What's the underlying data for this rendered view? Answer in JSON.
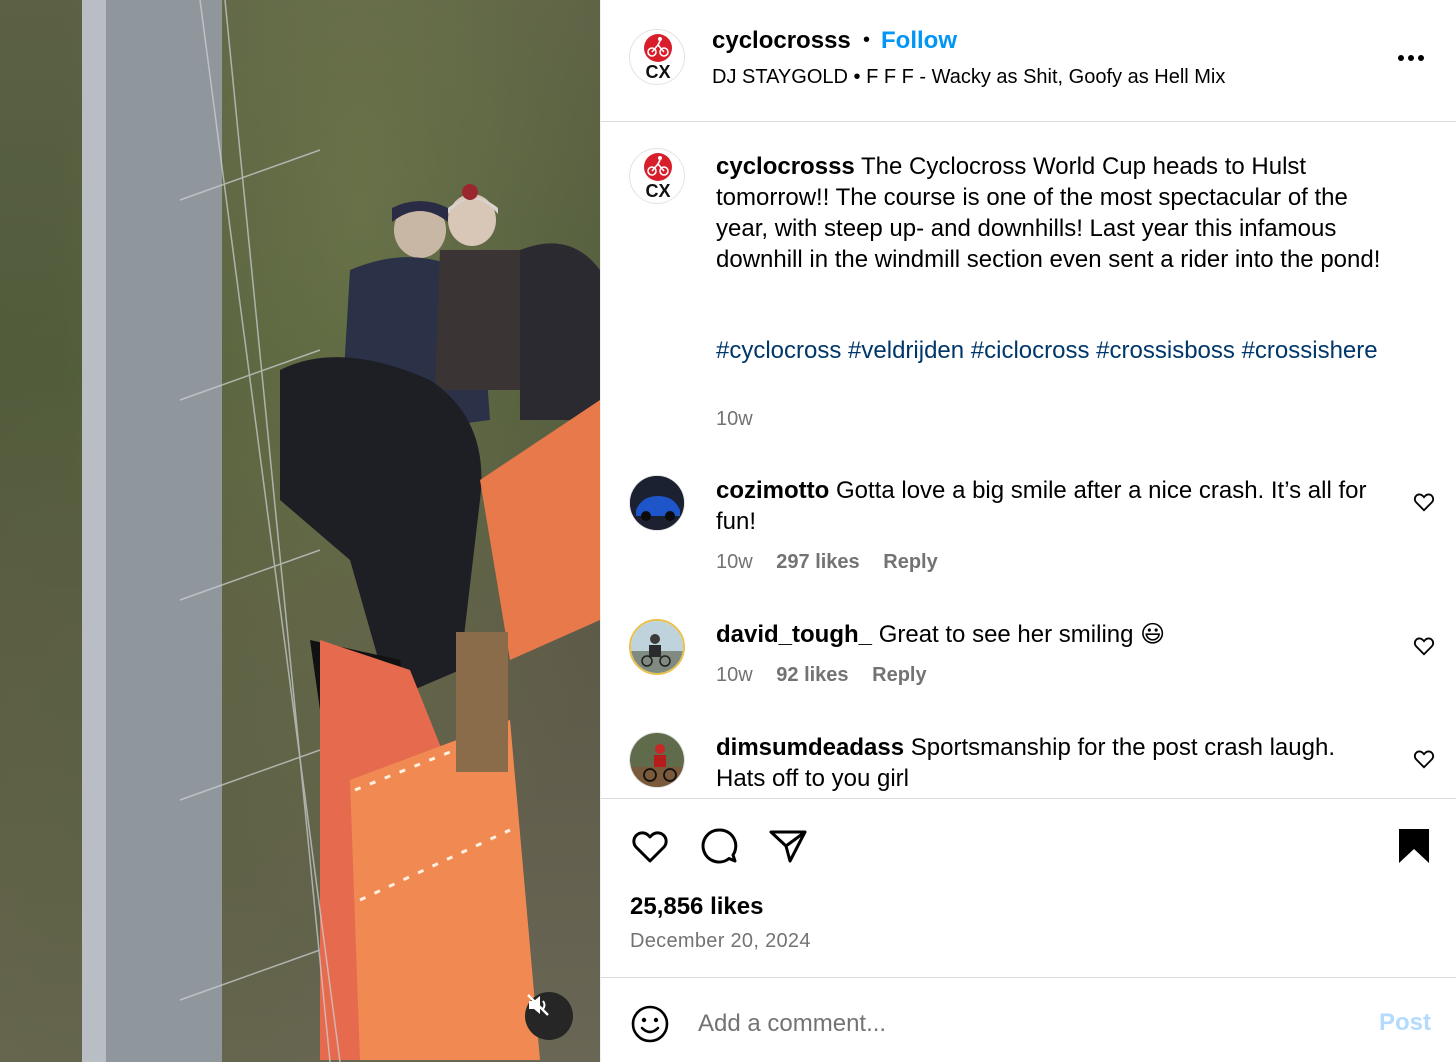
{
  "header": {
    "username": "cyclocrosss",
    "separator": "•",
    "follow_label": "Follow",
    "audio": "DJ STAYGOLD • F F F - Wacky as Shit, Goofy as Hell Mix",
    "avatar_text": "CX"
  },
  "caption": {
    "username": "cyclocrosss",
    "text": "The Cyclocross World Cup heads to Hulst tomorrow!! The course is one of the most spectacular of the year, with steep up- and downhills! Last year this infamous downhill in the windmill section even sent a rider into the pond!",
    "hashtags": [
      "#cyclocross",
      "#veldrijden",
      "#ciclocross",
      "#crossisboss",
      "#crossishere"
    ],
    "time": "10w"
  },
  "comments": [
    {
      "username": "cozimotto",
      "text": "Gotta love a big smile after a nice crash. It’s all for fun!",
      "time": "10w",
      "likes": "297 likes",
      "reply": "Reply"
    },
    {
      "username": "david_tough_",
      "text": "Great to see her smiling 😃",
      "time": "10w",
      "likes": "92 likes",
      "reply": "Reply"
    },
    {
      "username": "dimsumdeadass",
      "text": "Sportsmanship for the post crash laugh. Hats off to you girl",
      "time": "",
      "likes": "",
      "reply": ""
    }
  ],
  "post": {
    "likes": "25,856 likes",
    "date": "December 20, 2024"
  },
  "add_comment": {
    "placeholder": "Add a comment...",
    "post_label": "Post"
  },
  "colors": {
    "accent": "#0095f6",
    "hashtag": "#00376b",
    "muted": "#737373",
    "post_disabled": "#b3dbff"
  },
  "icons": [
    "more-icon",
    "heart-icon",
    "comment-icon",
    "share-icon",
    "bookmark-icon",
    "emoji-icon",
    "mute-icon"
  ]
}
